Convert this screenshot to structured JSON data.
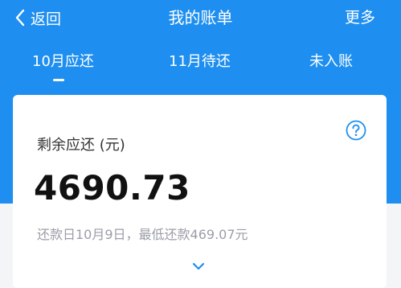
{
  "nav": {
    "back_label": "返回",
    "title": "我的账单",
    "more_label": "更多"
  },
  "tabs": [
    {
      "label": "10月应还",
      "active": true
    },
    {
      "label": "11月待还",
      "active": false
    },
    {
      "label": "未入账",
      "active": false
    }
  ],
  "bill": {
    "label": "剩余应还 (元)",
    "amount": "4690.73",
    "due_info": "还款日10月9日，最低还款469.07元"
  },
  "icons": {
    "back": "chevron-left-icon",
    "help": "question-circle-icon",
    "expand": "chevron-down-icon"
  },
  "colors": {
    "brand": "#1e8ff0",
    "card": "#ffffff",
    "page_background": "#f4f5f7",
    "amount_text": "#111111",
    "secondary_text": "#9a9ea6"
  }
}
